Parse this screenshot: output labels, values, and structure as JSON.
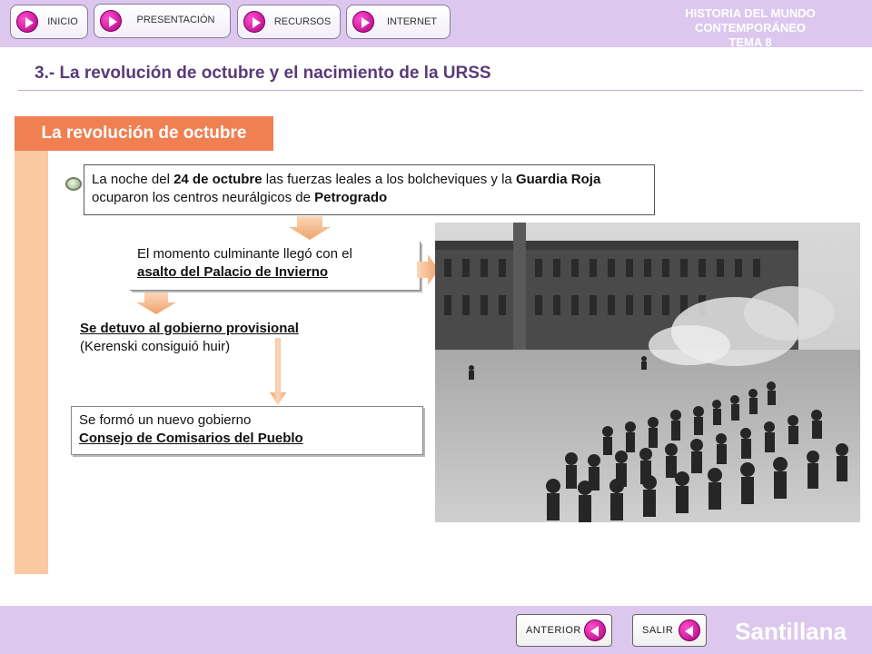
{
  "nav": {
    "inicio": "INICIO",
    "presentacion": "PRESENTACIÓN",
    "recursos": "RECURSOS",
    "internet": "INTERNET"
  },
  "header": {
    "course_line1": "HISTORIA DEL MUNDO CONTEMPORÁNEO",
    "course_line2": "TEMA 8",
    "title": "3.- La revolución de octubre y el nacimiento de la URSS"
  },
  "section": {
    "tab_label": "La revolución de octubre"
  },
  "content": {
    "box1": {
      "t1": "La noche del ",
      "t2": "24 de octubre",
      "t3": " las fuerzas leales a los bolcheviques y la ",
      "t4": "Guardia Roja",
      "t5": " ocuparon los centros neurálgicos de ",
      "t6": "Petrogrado"
    },
    "box2": {
      "line1": "El momento culminante llegó con el",
      "line2": "asalto del Palacio de Invierno"
    },
    "box3": {
      "line1": "Se detuvo al gobierno provisional",
      "line2": "(Kerenski consiguió huir)"
    },
    "box4": {
      "line1": "Se formó un nuevo gobierno",
      "line2": "Consejo de Comisarios  del Pueblo"
    }
  },
  "footer": {
    "anterior": "ANTERIOR",
    "salir": "SALIR",
    "brand": "Santillana"
  },
  "colors": {
    "topbar": "#dcc8ee",
    "section_tab": "#f07f52",
    "column": "#f9c9a2",
    "arrow": "#f5b98a",
    "accent": "#c4008c"
  }
}
